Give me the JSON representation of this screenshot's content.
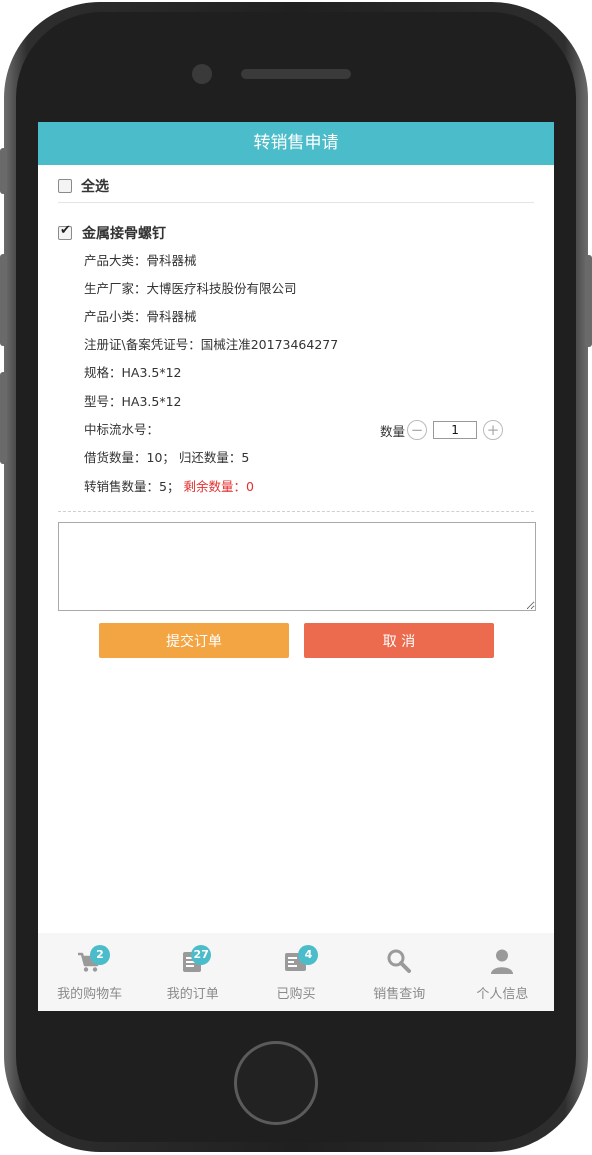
{
  "header": {
    "title": "转销售申请"
  },
  "select_all": {
    "label": "全选",
    "checked": false
  },
  "product": {
    "checked": true,
    "name": "金属接骨螺钉",
    "category_major": "产品大类：骨科器械",
    "manufacturer": "生产厂家：大博医疗科技股份有限公司",
    "category_minor": "产品小类：骨科器械",
    "registration": "注册证\\备案凭证号：国械注准20173464277",
    "spec": "规格：HA3.5*12",
    "model": "型号：HA3.5*12",
    "serial": "中标流水号：",
    "loan_return": "借货数量：10；  归还数量：5",
    "transfer": "转销售数量：5；",
    "remaining": "剩余数量：0",
    "quantity_label": "数量",
    "quantity_value": "1",
    "minus_symbol": "−",
    "plus_symbol": "+"
  },
  "remark": {
    "value": ""
  },
  "actions": {
    "submit_label": "提交订单",
    "cancel_label": "取 消"
  },
  "tabs": [
    {
      "label": "我的购物车",
      "icon": "cart-icon",
      "badge": "2"
    },
    {
      "label": "我的订单",
      "icon": "order-icon",
      "badge": "27"
    },
    {
      "label": "已购买",
      "icon": "purchased-icon",
      "badge": "4"
    },
    {
      "label": "销售查询",
      "icon": "search-icon",
      "badge": ""
    },
    {
      "label": "个人信息",
      "icon": "user-icon",
      "badge": ""
    }
  ],
  "colors": {
    "accent": "#4bbcca",
    "submit": "#f3a544",
    "cancel": "#ec6a4d",
    "warning_text": "#e62e2e"
  }
}
